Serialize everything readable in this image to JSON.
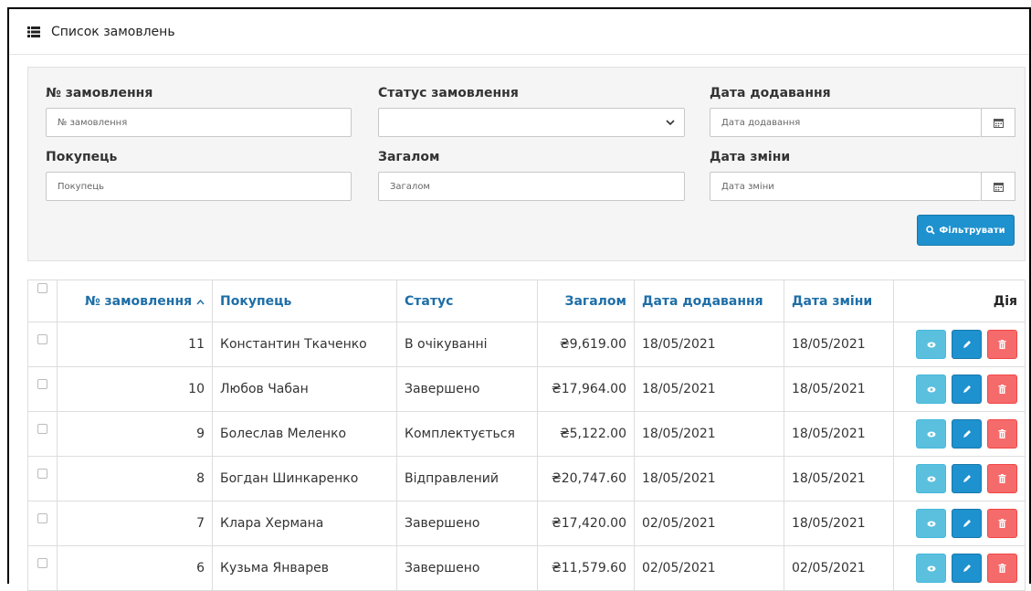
{
  "panel": {
    "title": "Список замовлень",
    "icon": "list-icon"
  },
  "filters": {
    "order_id": {
      "label": "№ замовлення",
      "placeholder": "№ замовлення"
    },
    "status": {
      "label": "Статус замовлення",
      "value": ""
    },
    "date_added": {
      "label": "Дата додавання",
      "placeholder": "Дата додавання"
    },
    "customer": {
      "label": "Покупець",
      "placeholder": "Покупець"
    },
    "total": {
      "label": "Загалом",
      "placeholder": "Загалом"
    },
    "date_modified": {
      "label": "Дата зміни",
      "placeholder": "Дата зміни"
    },
    "button_label": "Фільтрувати"
  },
  "table": {
    "headers": {
      "order_id": "№ замовлення",
      "customer": "Покупець",
      "status": "Статус",
      "total": "Загалом",
      "date_added": "Дата додавання",
      "date_modified": "Дата зміни",
      "action": "Дія"
    },
    "rows": [
      {
        "order_id": "11",
        "customer": "Константин Ткаченко",
        "status": "В очікуванні",
        "total": "₴9,619.00",
        "date_added": "18/05/2021",
        "date_modified": "18/05/2021"
      },
      {
        "order_id": "10",
        "customer": "Любов Чабан",
        "status": "Завершено",
        "total": "₴17,964.00",
        "date_added": "18/05/2021",
        "date_modified": "18/05/2021"
      },
      {
        "order_id": "9",
        "customer": "Болеслав Меленко",
        "status": "Комплектується",
        "total": "₴5,122.00",
        "date_added": "18/05/2021",
        "date_modified": "18/05/2021"
      },
      {
        "order_id": "8",
        "customer": "Богдан Шинкаренко",
        "status": "Відправлений",
        "total": "₴20,747.60",
        "date_added": "18/05/2021",
        "date_modified": "18/05/2021"
      },
      {
        "order_id": "7",
        "customer": "Клара Хермана",
        "status": "Завершено",
        "total": "₴17,420.00",
        "date_added": "02/05/2021",
        "date_modified": "18/05/2021"
      },
      {
        "order_id": "6",
        "customer": "Кузьма Январев",
        "status": "Завершено",
        "total": "₴11,579.60",
        "date_added": "02/05/2021",
        "date_modified": "02/05/2021"
      }
    ]
  },
  "colors": {
    "link": "#1e6ea7",
    "primary": "#1e91cf",
    "info": "#5bc0de",
    "danger": "#f56b6b"
  }
}
